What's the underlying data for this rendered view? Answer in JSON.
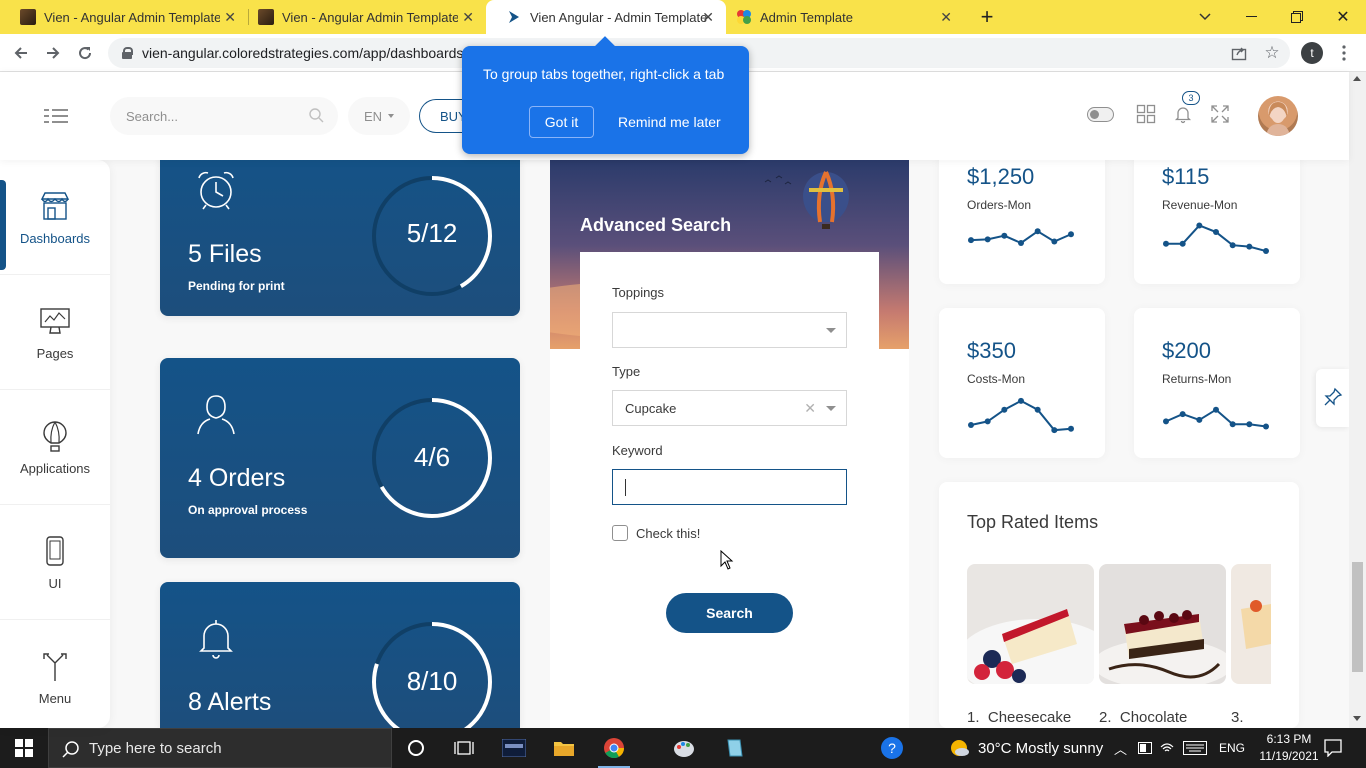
{
  "browser": {
    "tabs": [
      {
        "title": "Vien - Angular Admin Template b",
        "active": false,
        "icon": "dark-logo-favicon"
      },
      {
        "title": "Vien - Angular Admin Template F",
        "active": false,
        "icon": "dark-logo-favicon"
      },
      {
        "title": "Vien Angular - Admin Template",
        "active": true,
        "icon": "vien-favicon"
      },
      {
        "title": "Admin Template",
        "active": false,
        "icon": "colored-circles-favicon"
      }
    ],
    "new_tab_symbol": "+",
    "url": "vien-angular.coloredstrategies.com/app/dashboards",
    "profile_initial": "t",
    "bubble": {
      "message": "To group tabs together, right-click a tab",
      "got_it": "Got it",
      "remind_later": "Remind me later"
    }
  },
  "navbar": {
    "search_placeholder": "Search...",
    "language": "EN",
    "buy_label": "BUY",
    "notification_count": "3"
  },
  "sidebar": {
    "items": [
      {
        "label": "Dashboards",
        "icon": "shop-icon",
        "active": true
      },
      {
        "label": "Pages",
        "icon": "monitor-icon",
        "active": false
      },
      {
        "label": "Applications",
        "icon": "balloon-icon",
        "active": false
      },
      {
        "label": "UI",
        "icon": "phone-icon",
        "active": false
      },
      {
        "label": "Menu",
        "icon": "split-arrows-icon",
        "active": false
      }
    ]
  },
  "stat_cards": [
    {
      "title": "5 Files",
      "subtitle": "Pending for print",
      "value": 5,
      "total": 12,
      "ring_label": "5/12",
      "icon": "alarm-clock-icon"
    },
    {
      "title": "4 Orders",
      "subtitle": "On approval process",
      "value": 4,
      "total": 6,
      "ring_label": "4/6",
      "icon": "user-icon"
    },
    {
      "title": "8 Alerts",
      "subtitle": "",
      "value": 8,
      "total": 10,
      "ring_label": "8/10",
      "icon": "bell-icon"
    }
  ],
  "advanced_search": {
    "title": "Advanced Search",
    "toppings_label": "Toppings",
    "toppings_value": "",
    "type_label": "Type",
    "type_value": "Cupcake",
    "keyword_label": "Keyword",
    "keyword_value": "",
    "check_label": "Check this!",
    "checked": false,
    "search_button": "Search"
  },
  "small_charts": [
    {
      "value": "$1,250",
      "label": "Orders-Mon",
      "points": [
        3,
        3.1,
        3.6,
        2.6,
        4.2,
        2.8,
        3.8
      ]
    },
    {
      "value": "$115",
      "label": "Revenue-Mon",
      "points": [
        2.5,
        2.5,
        5,
        4.1,
        2.3,
        2.1,
        1.5
      ]
    },
    {
      "value": "$350",
      "label": "Costs-Mon",
      "points": [
        1.5,
        2.0,
        3.6,
        4.8,
        3.6,
        0.8,
        1.0
      ]
    },
    {
      "value": "$200",
      "label": "Returns-Mon",
      "points": [
        2.0,
        3.0,
        2.2,
        3.6,
        1.6,
        1.6,
        1.3
      ]
    }
  ],
  "top_rated": {
    "title": "Top Rated Items",
    "items": [
      {
        "rank": "1.",
        "name": "Cheesecake"
      },
      {
        "rank": "2.",
        "name": "Chocolate"
      },
      {
        "rank": "3.",
        "name": ""
      }
    ]
  },
  "taskbar": {
    "search_placeholder": "Type here to search",
    "weather": "30°C  Mostly sunny",
    "language": "ENG",
    "time": "6:13 PM",
    "date": "11/19/2021"
  },
  "colors": {
    "theme": "#145388",
    "chrome_yellow": "#f9e24a",
    "bubble_blue": "#1a73e8"
  }
}
